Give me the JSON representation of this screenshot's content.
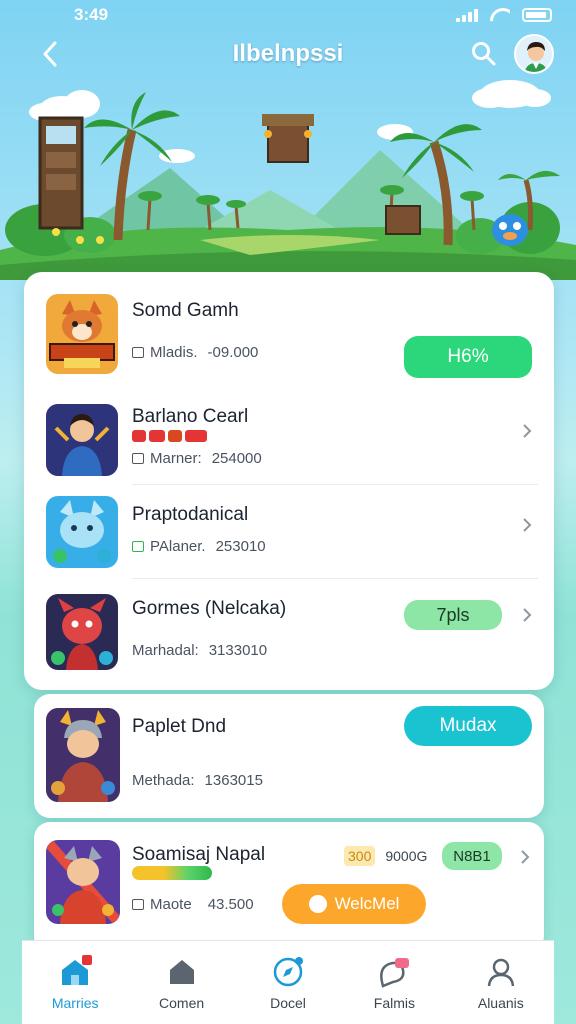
{
  "status_bar": {
    "time": "3:49"
  },
  "header": {
    "title": "Ilbelnpssi"
  },
  "games": [
    {
      "title": "Somd Gamh",
      "meta_label": "Mladis.",
      "meta_value": "-09.000",
      "action": "H6%"
    },
    {
      "title": "Barlano Cearl",
      "meta_label": "Marner:",
      "meta_value": "254000"
    },
    {
      "title": "Praptodanical",
      "meta_label": "PAlaner.",
      "meta_value": "253010"
    },
    {
      "title": "Gormes (Nelcaka)",
      "meta_label": "Marhadal:",
      "meta_value": "3133010",
      "badge": "7pls"
    },
    {
      "title": "Paplet Dnd",
      "meta_label": "Methada:",
      "meta_value": "1363015",
      "action": "Mudax"
    },
    {
      "title": "Soamisaj Napal",
      "meta_label": "Maote",
      "meta_value": "43.500",
      "tag_score": "300",
      "tag_text": "9000G",
      "tag_badge": "N8B1",
      "action": "WelcMel"
    }
  ],
  "nav": [
    {
      "label": "Marries",
      "icon": "home-icon",
      "active": true
    },
    {
      "label": "Comen",
      "icon": "house-icon",
      "active": false
    },
    {
      "label": "Docel",
      "icon": "compass-icon",
      "active": false
    },
    {
      "label": "Falmis",
      "icon": "chat-icon",
      "active": false
    },
    {
      "label": "Aluanis",
      "icon": "user-icon",
      "active": false
    }
  ],
  "colors": {
    "green": "#2bd77a",
    "teal": "#19c3cf",
    "orange": "#fca72c",
    "accent": "#1d9ad6"
  }
}
